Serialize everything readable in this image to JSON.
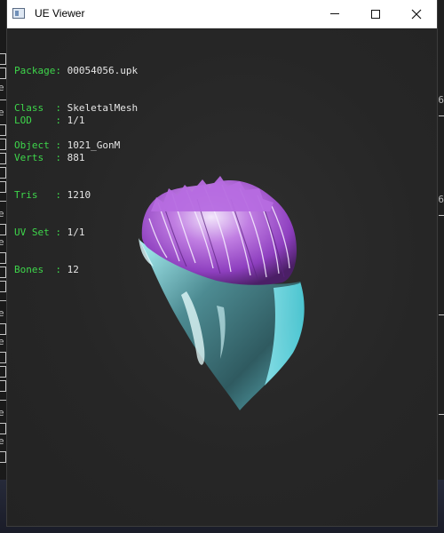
{
  "window": {
    "title": "UE Viewer",
    "controls": [
      "minimize",
      "maximize",
      "close"
    ]
  },
  "info_block_1": [
    {
      "label": "Package",
      "value": "00054056.upk"
    },
    {
      "label": "Class  ",
      "value": "SkeletalMesh"
    },
    {
      "label": "Object ",
      "value": "1021_GonM"
    }
  ],
  "info_block_2": [
    {
      "label": "LOD    ",
      "value": "1/1"
    },
    {
      "label": "Verts  ",
      "value": "881"
    },
    {
      "label": "Tris   ",
      "value": "1210"
    },
    {
      "label": "UV Set ",
      "value": "1/1"
    },
    {
      "label": "Bones  ",
      "value": "12"
    }
  ],
  "colors": {
    "label_green": "#3ed64b",
    "value_white": "#e6e6e6",
    "hair_purple": "#b35fd6",
    "mesh_cyan": "#79d6de",
    "viewport_bg": "#262626"
  },
  "background_right": {
    "digit": "6"
  }
}
